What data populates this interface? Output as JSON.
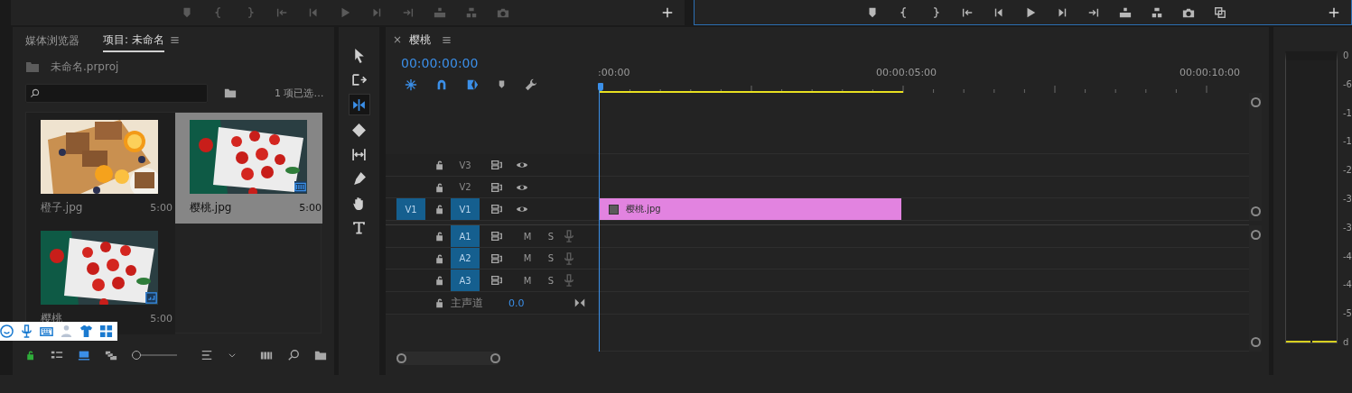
{
  "project_panel": {
    "tabs": [
      {
        "label": "媒体浏览器",
        "selected": false
      },
      {
        "label": "项目: 未命名",
        "selected": true
      }
    ],
    "project_file": "未命名.prproj",
    "selection_count": "1 项已选…",
    "items": [
      {
        "name": "橙子.jpg",
        "duration": "5:00",
        "selected": false
      },
      {
        "name": "樱桃.jpg",
        "duration": "5:00",
        "selected": true
      },
      {
        "name": "樱桃",
        "duration": "5:00",
        "selected": false,
        "kind": "sequence"
      }
    ],
    "zoom_slider": {
      "level": 0
    }
  },
  "tools": [
    {
      "selected": false
    },
    {
      "selected": false
    },
    {
      "selected": true
    },
    {
      "selected": false
    },
    {
      "selected": false
    },
    {
      "selected": false
    },
    {
      "selected": false
    },
    {
      "selected": false
    }
  ],
  "timeline": {
    "close": "×",
    "tab": "樱桃",
    "timecode": "00:00:00:00",
    "snap_on": true,
    "linked_on": true,
    "overwrite_on": true,
    "ruler": [
      ":00:00",
      "00:00:05:00",
      "00:00:10:00"
    ],
    "video_tracks": [
      {
        "name": "V3",
        "targeted": false
      },
      {
        "name": "V2",
        "targeted": false
      },
      {
        "name": "V1",
        "targeted": true,
        "source": "V1"
      }
    ],
    "audio_tracks": [
      {
        "name": "A1",
        "targeted": true,
        "mute": "M",
        "solo": "S"
      },
      {
        "name": "A2",
        "targeted": true,
        "mute": "M",
        "solo": "S"
      },
      {
        "name": "A3",
        "targeted": true,
        "mute": "M",
        "solo": "S"
      }
    ],
    "master": {
      "name": "主声道",
      "value": "0.0"
    },
    "clip": {
      "name": "樱桃.jpg"
    }
  },
  "meter": {
    "scale": [
      "0",
      "-6",
      "-1",
      "-1",
      "-2",
      "-3",
      "-3",
      "-4",
      "-4",
      "-5",
      "d"
    ]
  }
}
